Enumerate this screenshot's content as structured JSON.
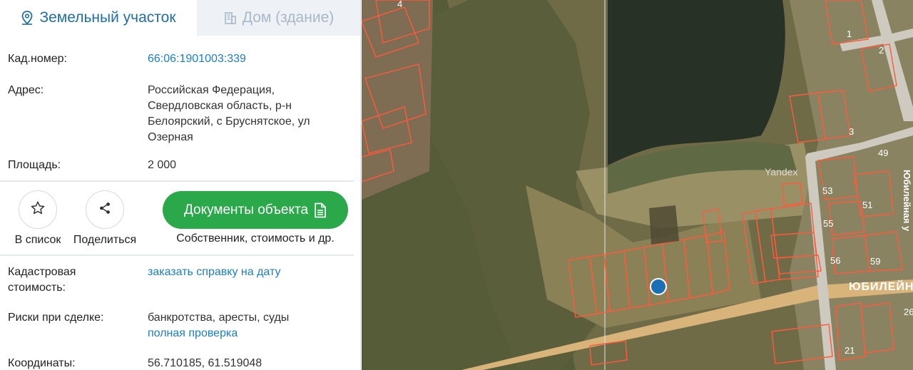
{
  "tabs": {
    "land": "Земельный участок",
    "house": "Дом (здание)"
  },
  "info": {
    "cadastral": {
      "label": "Кад.номер:",
      "value": "66:06:1901003:339"
    },
    "address": {
      "label": "Адрес:",
      "lines": [
        "Российская Федерация,",
        "Свердловская область, р-н",
        "Белоярский, с Бруснятское, ул",
        "Озерная"
      ]
    },
    "area": {
      "label": "Площадь:",
      "value": "2 000"
    }
  },
  "actions": {
    "favorite": "В список",
    "share": "Поделиться",
    "documents": "Документы объекта",
    "documents_sub": "Собственник, стоимость и др."
  },
  "details": {
    "cad_cost": {
      "label_lines": [
        "Кадастровая",
        "стоимость:"
      ],
      "link": "заказать справку на дату"
    },
    "risks": {
      "label": "Риски при сделке:",
      "text": "банкротства, аресты, суды",
      "link": "полная проверка"
    },
    "coords": {
      "label": "Координаты:",
      "value": "56.710185, 61.519048"
    }
  },
  "map": {
    "watermark": "Yandex",
    "street_main": "ЮБИЛЕЙН",
    "street_vertical": "Юбилейная у",
    "house_numbers": [
      "4",
      "1",
      "2",
      "3",
      "49",
      "53",
      "51",
      "55",
      "56",
      "59",
      "26",
      "21"
    ]
  },
  "colors": {
    "accent_blue": "#1d7ec8",
    "tab_blue": "#1f6ea6",
    "green": "#2ba84a",
    "parcel": "#ff5a3c",
    "marker": "#1a6fb5"
  }
}
